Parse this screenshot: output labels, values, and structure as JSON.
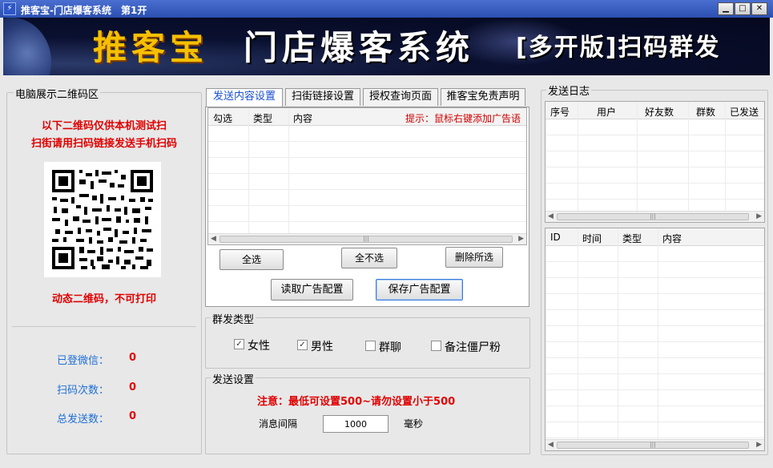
{
  "window": {
    "icon_glyph": "⚡",
    "title": "推客宝-门店爆客系统　第1开",
    "minimize_glyph": "▁",
    "maximize_glyph": "□",
    "close_glyph": "✕"
  },
  "banner": {
    "brand": "推客宝",
    "system": "门店爆客系统",
    "edition": "[多开版]扫码群发"
  },
  "left_panel": {
    "title": "电脑展示二维码区",
    "notice_line1": "以下二维码仅供本机测试扫",
    "notice_line2": "扫街请用扫码链接发送手机扫码",
    "qr_caption": "动态二维码，不可打印",
    "stats": [
      {
        "label": "已登微信：",
        "value": "0"
      },
      {
        "label": "扫码次数：",
        "value": "0"
      },
      {
        "label": "总发送数：",
        "value": "0"
      }
    ]
  },
  "tabs": [
    {
      "label": "发送内容设置",
      "active": true
    },
    {
      "label": "扫街链接设置",
      "active": false
    },
    {
      "label": "授权查询页面",
      "active": false
    },
    {
      "label": "推客宝免责声明",
      "active": false
    }
  ],
  "content_table": {
    "columns": [
      "勾选",
      "类型",
      "内容"
    ],
    "hint": "提示：鼠标右键添加广告语",
    "scroll_thumb": "|||"
  },
  "buttons": {
    "select_all": "全选",
    "select_none": "全不选",
    "delete_selected": "删除所选",
    "load_config": "读取广告配置",
    "save_config": "保存广告配置"
  },
  "group_type": {
    "title": "群发类型",
    "options": [
      {
        "label": "女性",
        "checked": true
      },
      {
        "label": "男性",
        "checked": true
      },
      {
        "label": "群聊",
        "checked": false
      },
      {
        "label": "备注僵尸粉",
        "checked": false
      }
    ]
  },
  "send_settings": {
    "title": "发送设置",
    "warning": "注意：最低可设置500~请勿设置小于500",
    "interval_label": "消息间隔",
    "interval_value": "1000",
    "unit": "毫秒"
  },
  "send_log": {
    "title": "发送日志",
    "columns": [
      "序号",
      "用户",
      "好友数",
      "群数",
      "已发送"
    ],
    "scroll_thumb": "|||"
  },
  "event_log": {
    "columns": [
      "ID",
      "时间",
      "类型",
      "内容"
    ],
    "scroll_thumb": "|||"
  }
}
